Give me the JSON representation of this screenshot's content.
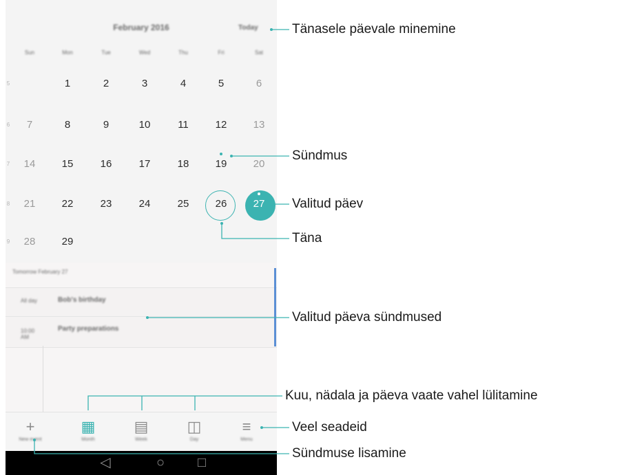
{
  "header": {
    "month_title": "February 2016",
    "today_button": "Today"
  },
  "weekdays": [
    "Sun",
    "Mon",
    "Tue",
    "Wed",
    "Thu",
    "Fri",
    "Sat"
  ],
  "weeks": [
    {
      "number": "5",
      "days": [
        "",
        "1",
        "2",
        "3",
        "4",
        "5",
        "6"
      ]
    },
    {
      "number": "6",
      "days": [
        "7",
        "8",
        "9",
        "10",
        "11",
        "12",
        "13"
      ]
    },
    {
      "number": "7",
      "days": [
        "14",
        "15",
        "16",
        "17",
        "18",
        "19",
        "20"
      ]
    },
    {
      "number": "8",
      "days": [
        "21",
        "22",
        "23",
        "24",
        "25",
        "26",
        "27"
      ]
    },
    {
      "number": "9",
      "days": [
        "28",
        "29",
        "",
        "",
        "",
        "",
        ""
      ]
    }
  ],
  "today": "26",
  "selected_day": "27",
  "event_days": [
    "19",
    "27"
  ],
  "accent_color": "#3bb3b1",
  "event_bar_color": "#5b8fd5",
  "events": {
    "list_header": "Tomorrow February 27",
    "items": [
      {
        "time": "All day",
        "title": "Bob's birthday"
      },
      {
        "time": "10:00 AM",
        "title": "Party preparations"
      }
    ]
  },
  "tabs": [
    {
      "label": "New event",
      "icon": "plus-icon",
      "glyph": "+"
    },
    {
      "label": "Month",
      "icon": "month-view-icon",
      "glyph": "▦",
      "active": true
    },
    {
      "label": "Week",
      "icon": "week-view-icon",
      "glyph": "▤"
    },
    {
      "label": "Day",
      "icon": "day-view-icon",
      "glyph": "◫"
    },
    {
      "label": "Menu",
      "icon": "menu-icon",
      "glyph": "≡"
    }
  ],
  "nav": [
    {
      "icon": "back-icon",
      "glyph": "◁"
    },
    {
      "icon": "home-icon",
      "glyph": "○"
    },
    {
      "icon": "recents-icon",
      "glyph": "□"
    }
  ],
  "callouts": {
    "goto_today": "Tänasele päevale minemine",
    "event": "Sündmus",
    "selected_day": "Valitud päev",
    "today": "Täna",
    "selected_day_events": "Valitud päeva sündmused",
    "switch_views": "Kuu, nädala ja päeva vaate vahel lülitamine",
    "more_settings": "Veel seadeid",
    "add_event": "Sündmuse lisamine"
  }
}
